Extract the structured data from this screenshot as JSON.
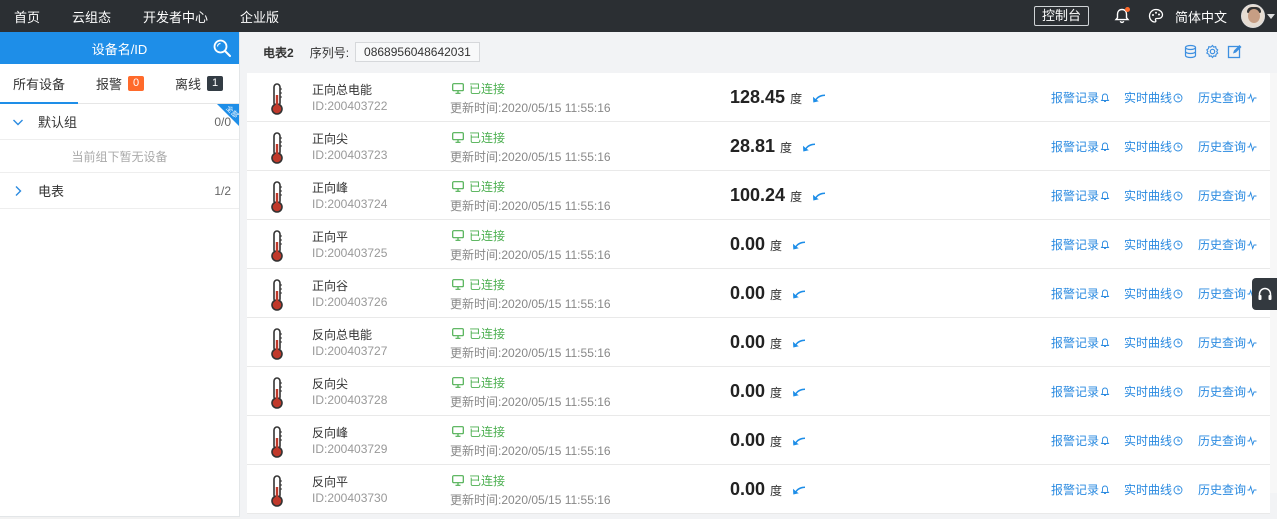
{
  "topbar": {
    "nav": [
      "首页",
      "云组态",
      "开发者中心",
      "企业版"
    ],
    "console_label": "控制台",
    "language": "简体中文"
  },
  "sidebar": {
    "search_label": "设备名/ID",
    "tabs": [
      {
        "label": "所有设备"
      },
      {
        "label": "报警",
        "badge": "0"
      },
      {
        "label": "离线",
        "badge": "1"
      }
    ],
    "corner_tag": "全部",
    "groups": [
      {
        "name": "默认组",
        "count": "0/0",
        "expanded": true,
        "empty_note": "当前组下暂无设备"
      },
      {
        "name": "电表",
        "count": "1/2",
        "expanded": false
      }
    ]
  },
  "main": {
    "device_title": "电表2",
    "serial_label": "序列号:",
    "serial_value": "0868956048642031",
    "rows": [
      {
        "name": "正向总电能",
        "id": "ID:200403722",
        "status": "已连接",
        "updated": "更新时间:2020/05/15 11:55:16",
        "value": "128.45",
        "unit": "度"
      },
      {
        "name": "正向尖",
        "id": "ID:200403723",
        "status": "已连接",
        "updated": "更新时间:2020/05/15 11:55:16",
        "value": "28.81",
        "unit": "度"
      },
      {
        "name": "正向峰",
        "id": "ID:200403724",
        "status": "已连接",
        "updated": "更新时间:2020/05/15 11:55:16",
        "value": "100.24",
        "unit": "度"
      },
      {
        "name": "正向平",
        "id": "ID:200403725",
        "status": "已连接",
        "updated": "更新时间:2020/05/15 11:55:16",
        "value": "0.00",
        "unit": "度"
      },
      {
        "name": "正向谷",
        "id": "ID:200403726",
        "status": "已连接",
        "updated": "更新时间:2020/05/15 11:55:16",
        "value": "0.00",
        "unit": "度"
      },
      {
        "name": "反向总电能",
        "id": "ID:200403727",
        "status": "已连接",
        "updated": "更新时间:2020/05/15 11:55:16",
        "value": "0.00",
        "unit": "度"
      },
      {
        "name": "反向尖",
        "id": "ID:200403728",
        "status": "已连接",
        "updated": "更新时间:2020/05/15 11:55:16",
        "value": "0.00",
        "unit": "度"
      },
      {
        "name": "反向峰",
        "id": "ID:200403729",
        "status": "已连接",
        "updated": "更新时间:2020/05/15 11:55:16",
        "value": "0.00",
        "unit": "度"
      },
      {
        "name": "反向平",
        "id": "ID:200403730",
        "status": "已连接",
        "updated": "更新时间:2020/05/15 11:55:16",
        "value": "0.00",
        "unit": "度"
      }
    ],
    "row_links": {
      "alarm": "报警记录",
      "realtime": "实时曲线",
      "history": "历史查询"
    }
  },
  "colors": {
    "accent": "#1e8ee8",
    "topbar": "#2b2f33",
    "connected": "#4caf50",
    "link": "#2a8ae0",
    "thermometer": "#c0392b"
  },
  "icons": [
    "search-icon",
    "bell-icon",
    "palette-icon",
    "chevron-down-icon",
    "chevron-right-icon",
    "thermometer-icon",
    "monitor-icon",
    "refresh-arrow-icon",
    "bell-small-icon",
    "clock-icon",
    "wave-icon",
    "database-icon",
    "gear-icon",
    "edit-icon",
    "headset-icon"
  ]
}
